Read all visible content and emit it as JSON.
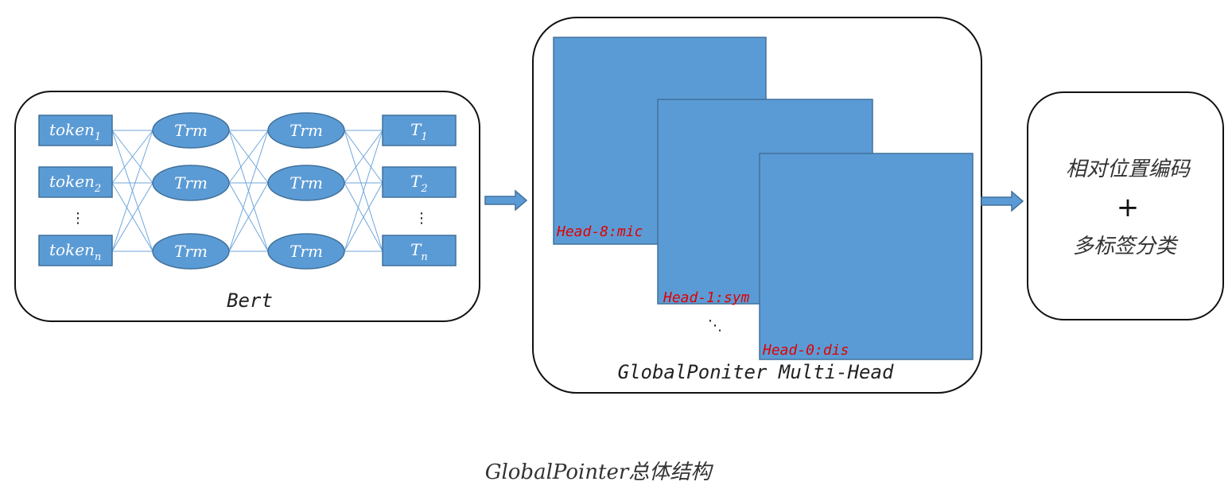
{
  "bert": {
    "label": "Bert",
    "inputs": [
      {
        "base": "token",
        "sub": "1"
      },
      {
        "base": "token",
        "sub": "2"
      },
      {
        "base": "token",
        "sub": "n"
      }
    ],
    "layers": [
      [
        "Trm",
        "Trm",
        "Trm"
      ],
      [
        "Trm",
        "Trm",
        "Trm"
      ]
    ],
    "outputs": [
      {
        "base": "T",
        "sub": "1"
      },
      {
        "base": "T",
        "sub": "2"
      },
      {
        "base": "T",
        "sub": "n"
      }
    ],
    "ellipsis": "⋮"
  },
  "multi_head": {
    "label": "GlobalPoniter Multi-Head",
    "heads": [
      "Head-8:mic",
      "Head-1:sym",
      "Head-0:dis"
    ],
    "ellipsis": "⋱"
  },
  "output_box": {
    "line1": "相对位置编码",
    "plus": "+",
    "line2": "多标签分类"
  },
  "caption": "GlobalPointer总体结构",
  "colors": {
    "node_fill": "#5b9bd5",
    "node_stroke": "#41719c",
    "head_label": "#e00000"
  }
}
